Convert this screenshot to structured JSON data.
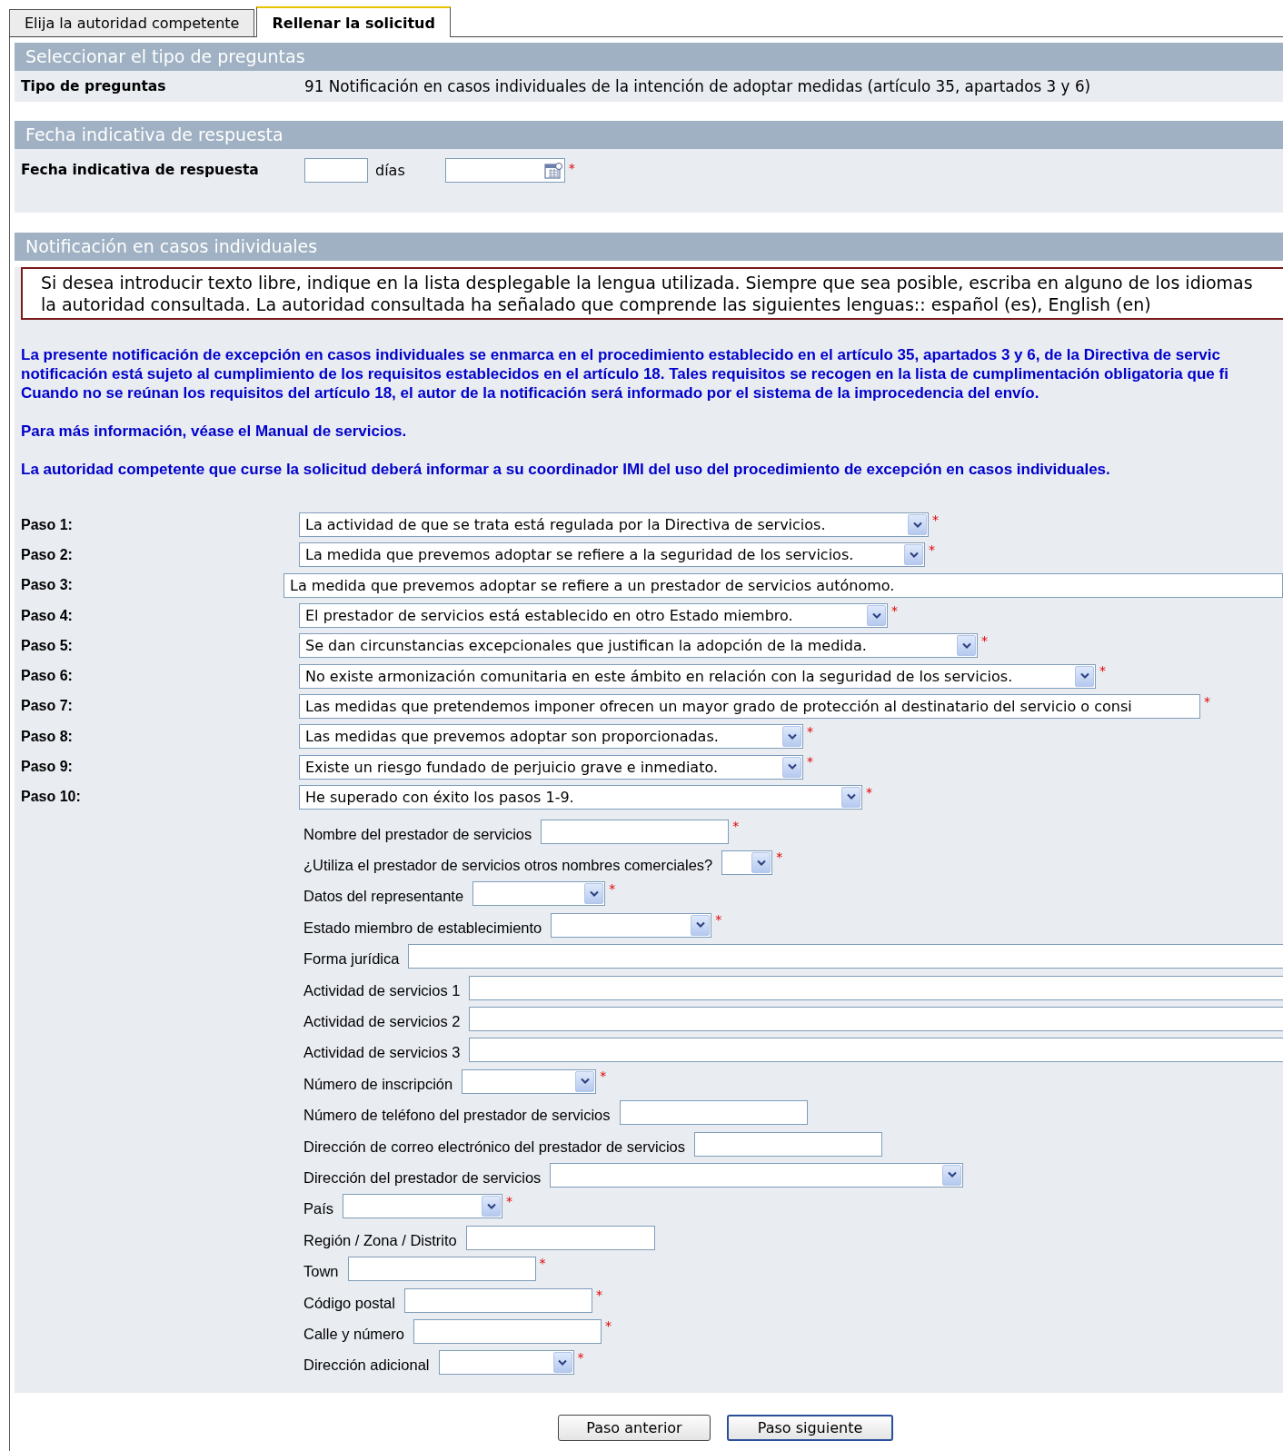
{
  "tabs": [
    {
      "label": "Elija la autoridad competente",
      "selected": false
    },
    {
      "label": "Rellenar la solicitud",
      "selected": true
    }
  ],
  "required_mark": "*",
  "tipo_section": {
    "header": "Seleccionar el tipo de preguntas",
    "label": "Tipo de preguntas",
    "value": "91 Notificación en casos individuales de la intención de adoptar medidas (artículo 35, apartados 3 y 6)"
  },
  "fecha_section": {
    "header": "Fecha indicativa de respuesta",
    "label": "Fecha indicativa de respuesta",
    "unit": "días",
    "required": true
  },
  "notificacion_section": {
    "header": "Notificación en casos individuales",
    "notice_lines": [
      "Si desea introducir texto libre, indique en la lista desplegable la lengua utilizada. Siempre que sea posible, escriba en alguno de los idiomas",
      "la autoridad consultada. La autoridad consultada ha señalado que comprende las siguientes lenguas:: español (es), English (en)"
    ],
    "info_paragraphs": [
      {
        "lines": [
          "La presente notificación de excepción en casos individuales se enmarca en el procedimiento establecido en el artículo 35, apartados 3 y 6, de la Directiva de servic",
          "notificación está sujeto al cumplimiento de los requisitos establecidos en el artículo 18. Tales requisitos se recogen en la lista de cumplimentación obligatoria que fi",
          "Cuando no se reúnan los requisitos del artículo 18, el autor de la notificación será informado por el sistema de la improcedencia del envío."
        ]
      },
      {
        "lines": [
          "Para más información, véase el Manual de servicios."
        ]
      },
      {
        "lines": [
          "La autoridad competente que curse la solicitud deberá informar a su coordinador IMI del uso del procedimiento de excepción en casos individuales."
        ]
      }
    ],
    "steps": [
      {
        "label": "Paso 1:",
        "kind": "select",
        "value": "La actividad de que se trata está regulada por la Directiva de servicios.",
        "required": true
      },
      {
        "label": "Paso 2:",
        "kind": "select",
        "value": "La medida que prevemos adoptar se refiere a la seguridad de los servicios.",
        "required": true
      },
      {
        "label": "Paso 3:",
        "kind": "text",
        "value": "La medida que prevemos adoptar se refiere a un prestador de servicios autónomo.",
        "required": false
      },
      {
        "label": "Paso 4:",
        "kind": "select",
        "value": "El prestador de servicios está establecido en otro Estado miembro.",
        "required": true
      },
      {
        "label": "Paso 5:",
        "kind": "select",
        "value": "Se dan circunstancias excepcionales que justifican la adopción de la medida.",
        "required": true
      },
      {
        "label": "Paso 6:",
        "kind": "select",
        "value": "No existe armonización comunitaria en este ámbito en relación con la seguridad de los servicios.",
        "required": true
      },
      {
        "label": "Paso 7:",
        "kind": "text",
        "value": "Las medidas que pretendemos imponer ofrecen un mayor grado de protección al destinatario del servicio o consi",
        "required": true
      },
      {
        "label": "Paso 8:",
        "kind": "select",
        "value": "Las medidas que prevemos adoptar son proporcionadas.",
        "required": true
      },
      {
        "label": "Paso 9:",
        "kind": "select",
        "value": "Existe un riesgo fundado de perjuicio grave e inmediato.",
        "required": true
      },
      {
        "label": "Paso 10:",
        "kind": "select",
        "value": "He superado con éxito los pasos 1-9.",
        "required": true
      }
    ],
    "fields": [
      {
        "label": "Nombre del prestador de servicios",
        "kind": "text",
        "required": true
      },
      {
        "label": "¿Utiliza el prestador de servicios otros nombres comerciales?",
        "kind": "select",
        "required": true
      },
      {
        "label": "Datos del representante",
        "kind": "select",
        "required": true
      },
      {
        "label": "Estado miembro de establecimiento",
        "kind": "select",
        "required": true
      },
      {
        "label": "Forma jurídica",
        "kind": "text",
        "required": false
      },
      {
        "label": "Actividad de servicios 1",
        "kind": "text",
        "required": false
      },
      {
        "label": "Actividad de servicios 2",
        "kind": "text",
        "required": false
      },
      {
        "label": "Actividad de servicios 3",
        "kind": "text",
        "required": false
      },
      {
        "label": "Número de inscripción",
        "kind": "select",
        "required": true
      },
      {
        "label": "Número de teléfono del prestador de servicios",
        "kind": "text",
        "required": false
      },
      {
        "label": "Dirección de correo electrónico del prestador de servicios",
        "kind": "text",
        "required": false
      },
      {
        "label": "Dirección del prestador de servicios",
        "kind": "select",
        "required": false
      },
      {
        "label": "País",
        "kind": "select",
        "required": true
      },
      {
        "label": "Región / Zona / Distrito",
        "kind": "text",
        "required": false
      },
      {
        "label": "Town",
        "kind": "text",
        "required": true
      },
      {
        "label": "Código postal",
        "kind": "text",
        "required": true
      },
      {
        "label": "Calle y número",
        "kind": "text",
        "required": true
      },
      {
        "label": "Dirección adicional",
        "kind": "select",
        "required": true
      }
    ]
  },
  "buttons": [
    {
      "label": "Paso anterior",
      "default": false
    },
    {
      "label": "Paso siguiente",
      "default": true
    }
  ]
}
